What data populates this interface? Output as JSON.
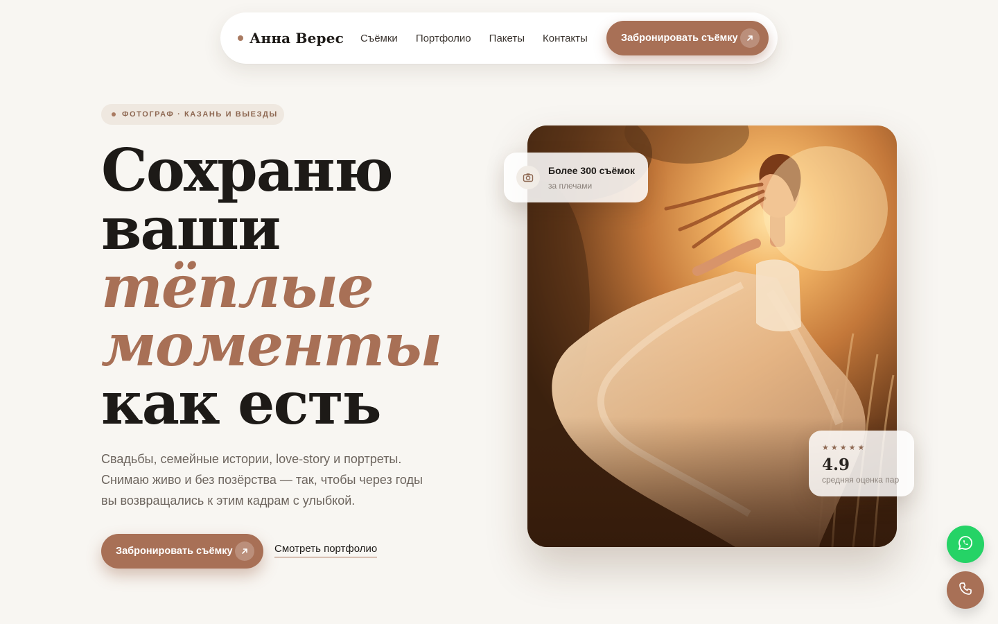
{
  "nav": {
    "brand": "Анна Верес",
    "links": [
      "Съёмки",
      "Портфолио",
      "Пакеты",
      "Контакты"
    ],
    "cta_label": "Забронировать съёмку"
  },
  "hero": {
    "eyebrow": "ФОТОГРАФ · КАЗАНЬ И ВЫЕЗДЫ",
    "headline": {
      "line1": "Сохраню",
      "line2": "ваши",
      "accent1": "тёплые",
      "accent2": "моменты",
      "line3": "как есть"
    },
    "subtitle": "Свадьбы, семейные истории, love-story и портреты. Снимаю живо и без позёрства — так, чтобы через годы вы возвращались к этим кадрам с улыбкой.",
    "cta_label": "Забронировать съёмку",
    "link_label": "Смотреть портфолио"
  },
  "badges": {
    "experience_title": "Более 300 съёмок",
    "experience_sub": "за плечами",
    "stars": "★★★★★",
    "rating": "4.9",
    "rating_label": "средняя оценка пар"
  },
  "icons": {
    "cta_arrow": "arrow-up-right-icon",
    "experience": "camera-icon",
    "chat": "whatsapp-icon",
    "phone": "phone-icon"
  },
  "colors": {
    "accent": "#a87056",
    "background": "#f8f6f2",
    "text": "#1d1a17",
    "chat_green": "#25d366"
  }
}
